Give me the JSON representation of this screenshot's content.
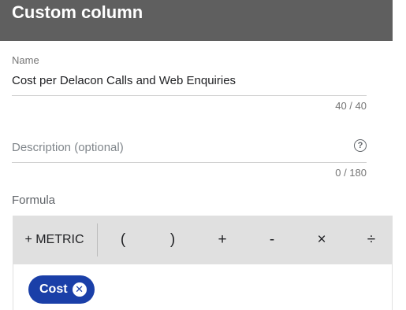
{
  "header": {
    "title": "Custom column"
  },
  "name_field": {
    "label": "Name",
    "value": "Cost per Delacon Calls and Web Enquiries",
    "counter": "40 / 40"
  },
  "description_field": {
    "placeholder": "Description (optional)",
    "counter": "0 / 180",
    "help_icon": "?"
  },
  "formula": {
    "label": "Formula",
    "toolbar": {
      "metric": "+ METRIC",
      "open_paren": "(",
      "close_paren": ")",
      "plus": "+",
      "minus": "-",
      "times": "×",
      "divide": "÷"
    },
    "chips": [
      {
        "label": "Cost",
        "remove_icon": "✕"
      }
    ]
  },
  "colors": {
    "header_bg": "#5f5f5f",
    "chip_bg": "#1a3fa8",
    "toolbar_bg": "#e0e0e0"
  }
}
